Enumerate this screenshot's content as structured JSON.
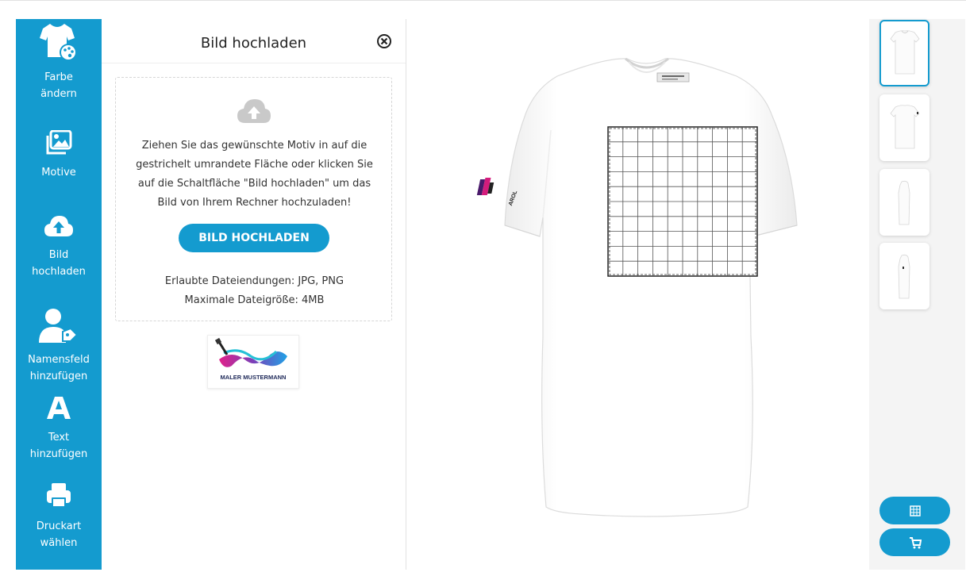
{
  "toolbar": {
    "items": [
      {
        "label_line1": "Farbe",
        "label_line2": "ändern",
        "icon": "tshirt-palette-icon"
      },
      {
        "label_line1": "Motive",
        "label_line2": "",
        "icon": "image-gallery-icon"
      },
      {
        "label_line1": "Bild",
        "label_line2": "hochladen",
        "icon": "cloud-upload-icon"
      },
      {
        "label_line1": "Namensfeld",
        "label_line2": "hinzufügen",
        "icon": "user-tag-icon"
      },
      {
        "label_line1": "Text",
        "label_line2": "hinzufügen",
        "icon": "text-a-icon"
      },
      {
        "label_line1": "Druckart",
        "label_line2": "wählen",
        "icon": "printer-icon"
      }
    ]
  },
  "panel": {
    "title": "Bild hochladen",
    "instructions": [
      "Ziehen Sie das gewünschte Motiv in auf die",
      "gestrichelt umrandete Fläche oder klicken Sie",
      "auf die Schaltfläche \"Bild hochladen\" um das",
      "Bild von Ihrem Rechner hochzuladen!"
    ],
    "upload_button": "BILD HOCHLADEN",
    "allowed_types": "Erlaubte Dateiendungen: JPG, PNG",
    "max_size": "Maximale Dateigröße: 4MB",
    "logo_caption": "MALER MUSTERMANN"
  },
  "product": {
    "label": "AROL"
  },
  "views": [
    "front",
    "back",
    "left-side",
    "right-side"
  ],
  "actions": {
    "grid_icon": "grid-icon",
    "cart_icon": "cart-icon"
  },
  "colors": {
    "accent": "#149bcf",
    "background": "#f4f4f4"
  }
}
